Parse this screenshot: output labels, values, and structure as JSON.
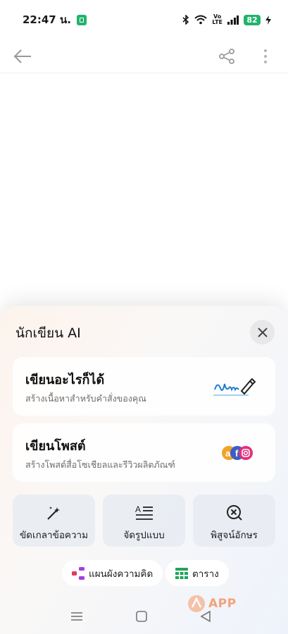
{
  "status_bar": {
    "time": "22:47 น.",
    "battery": "82"
  },
  "toolbar": {
    "back_icon": "arrow-left",
    "share_icon": "share",
    "more_icon": "more-vertical"
  },
  "sheet": {
    "title": "นักเขียน AI",
    "close_icon": "close",
    "cards": [
      {
        "title": "เขียนอะไรก็ได้",
        "subtitle": "สร้างเนื้อหาสำหรับคำสั่งของคุณ",
        "icon": "handwriting-pen"
      },
      {
        "title": "เขียนโพสต์",
        "subtitle": "สร้างโพสต์สื่อโซเชียลและรีวิวผลิตภัณฑ์",
        "icon": "social-logos"
      }
    ],
    "tools": [
      {
        "label": "ขัดเกลาข้อความ",
        "icon": "magic-wand"
      },
      {
        "label": "จัดรูปแบบ",
        "icon": "format-text"
      },
      {
        "label": "พิสูจน์อักษร",
        "icon": "proofread-check"
      }
    ],
    "chips": [
      {
        "label": "แผนผังความคิด",
        "icon": "mind-map"
      },
      {
        "label": "ตาราง",
        "icon": "table"
      }
    ]
  },
  "watermark": {
    "text": "APP"
  },
  "colors": {
    "accent_green": "#21b36b",
    "sheet_bg": "#faf8f7"
  }
}
